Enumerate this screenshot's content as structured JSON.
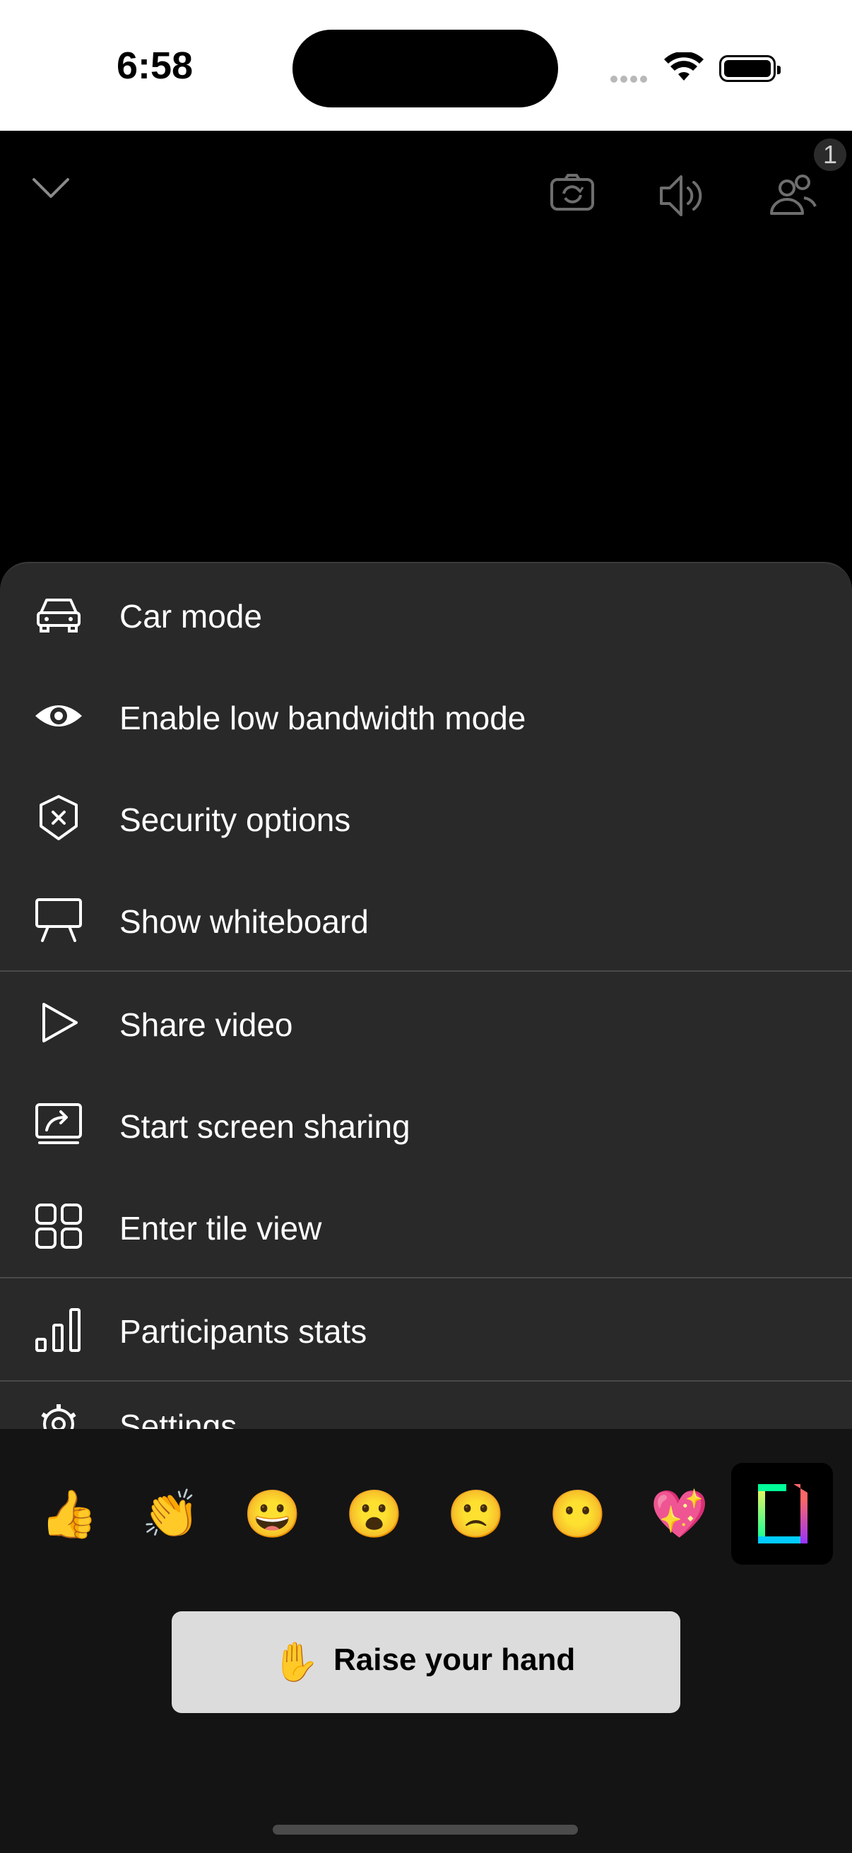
{
  "status_bar": {
    "time": "6:58"
  },
  "call": {
    "participants_count": "1"
  },
  "menu": {
    "items": [
      {
        "label": "Car mode",
        "icon": "car-icon"
      },
      {
        "label": "Enable low bandwidth mode",
        "icon": "eye-icon"
      },
      {
        "label": "Security options",
        "icon": "shield-icon"
      },
      {
        "label": "Show whiteboard",
        "icon": "whiteboard-icon"
      },
      {
        "label": "Share video",
        "icon": "play-icon"
      },
      {
        "label": "Start screen sharing",
        "icon": "screen-share-icon"
      },
      {
        "label": "Enter tile view",
        "icon": "tile-view-icon"
      },
      {
        "label": "Participants stats",
        "icon": "stats-icon"
      },
      {
        "label": "Settings",
        "icon": "gear-icon"
      }
    ]
  },
  "reactions": {
    "emojis": [
      "👍",
      "👏",
      "😀",
      "😮",
      "🙁",
      "😶",
      "💖"
    ],
    "gif_button": "gif-icon"
  },
  "raise_hand": {
    "emoji": "✋",
    "label": "Raise your hand"
  },
  "colors": {
    "sheet_bg": "#292929",
    "raise_bg": "#dcdcdc",
    "bottom_bg": "#141414"
  }
}
